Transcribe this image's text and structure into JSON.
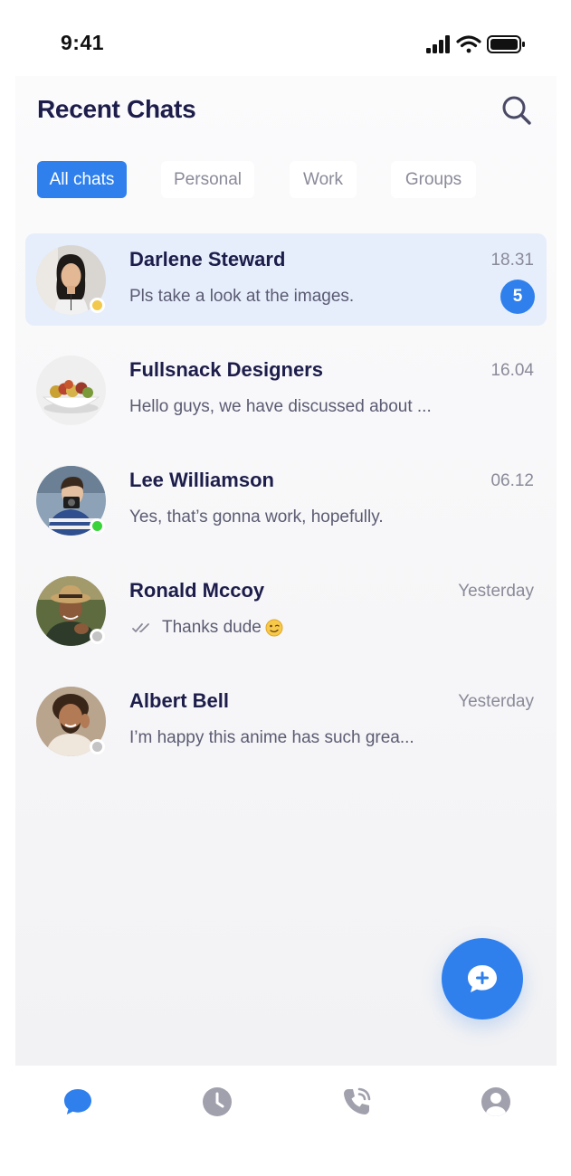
{
  "status_bar": {
    "time": "9:41",
    "icons": [
      "cellular-signal-icon",
      "wifi-icon",
      "battery-icon"
    ]
  },
  "header": {
    "title": "Recent Chats",
    "search_icon": "search-icon"
  },
  "filters": {
    "active_index": 0,
    "items": [
      {
        "label": "All chats"
      },
      {
        "label": "Personal"
      },
      {
        "label": "Work"
      },
      {
        "label": "Groups"
      }
    ]
  },
  "chats": [
    {
      "name": "Darlene Steward",
      "time": "18.31",
      "preview": "Pls take a look at the images.",
      "unread": "5",
      "presence": "away",
      "selected": true
    },
    {
      "name": "Fullsnack Designers",
      "time": "16.04",
      "preview": "Hello guys, we have discussed about ...",
      "unread": null,
      "presence": null,
      "selected": false
    },
    {
      "name": "Lee Williamson",
      "time": "06.12",
      "preview": "Yes, that’s gonna work, hopefully.",
      "unread": null,
      "presence": "online",
      "selected": false
    },
    {
      "name": "Ronald Mccoy",
      "time": "Yesterday",
      "preview": "Thanks dude",
      "preview_emoji": "wink-emoji",
      "read_receipt": "double-check-icon",
      "unread": null,
      "presence": "offline",
      "selected": false
    },
    {
      "name": "Albert Bell",
      "time": "Yesterday",
      "preview": "I’m happy this anime has such grea...",
      "unread": null,
      "presence": "offline",
      "selected": false
    }
  ],
  "fab": {
    "icon": "new-chat-icon"
  },
  "bottom_nav": {
    "active_index": 0,
    "items": [
      {
        "icon": "chat-bubble-icon"
      },
      {
        "icon": "clock-icon"
      },
      {
        "icon": "phone-call-icon"
      },
      {
        "icon": "user-profile-icon"
      }
    ]
  },
  "colors": {
    "accent": "#2f80ed",
    "title": "#1d1d4b",
    "muted": "#8a8a99",
    "selected_row": "#e6eefb",
    "presence_away": "#f2c94c",
    "presence_online": "#3bd33b",
    "presence_offline": "#c4c4c4"
  }
}
